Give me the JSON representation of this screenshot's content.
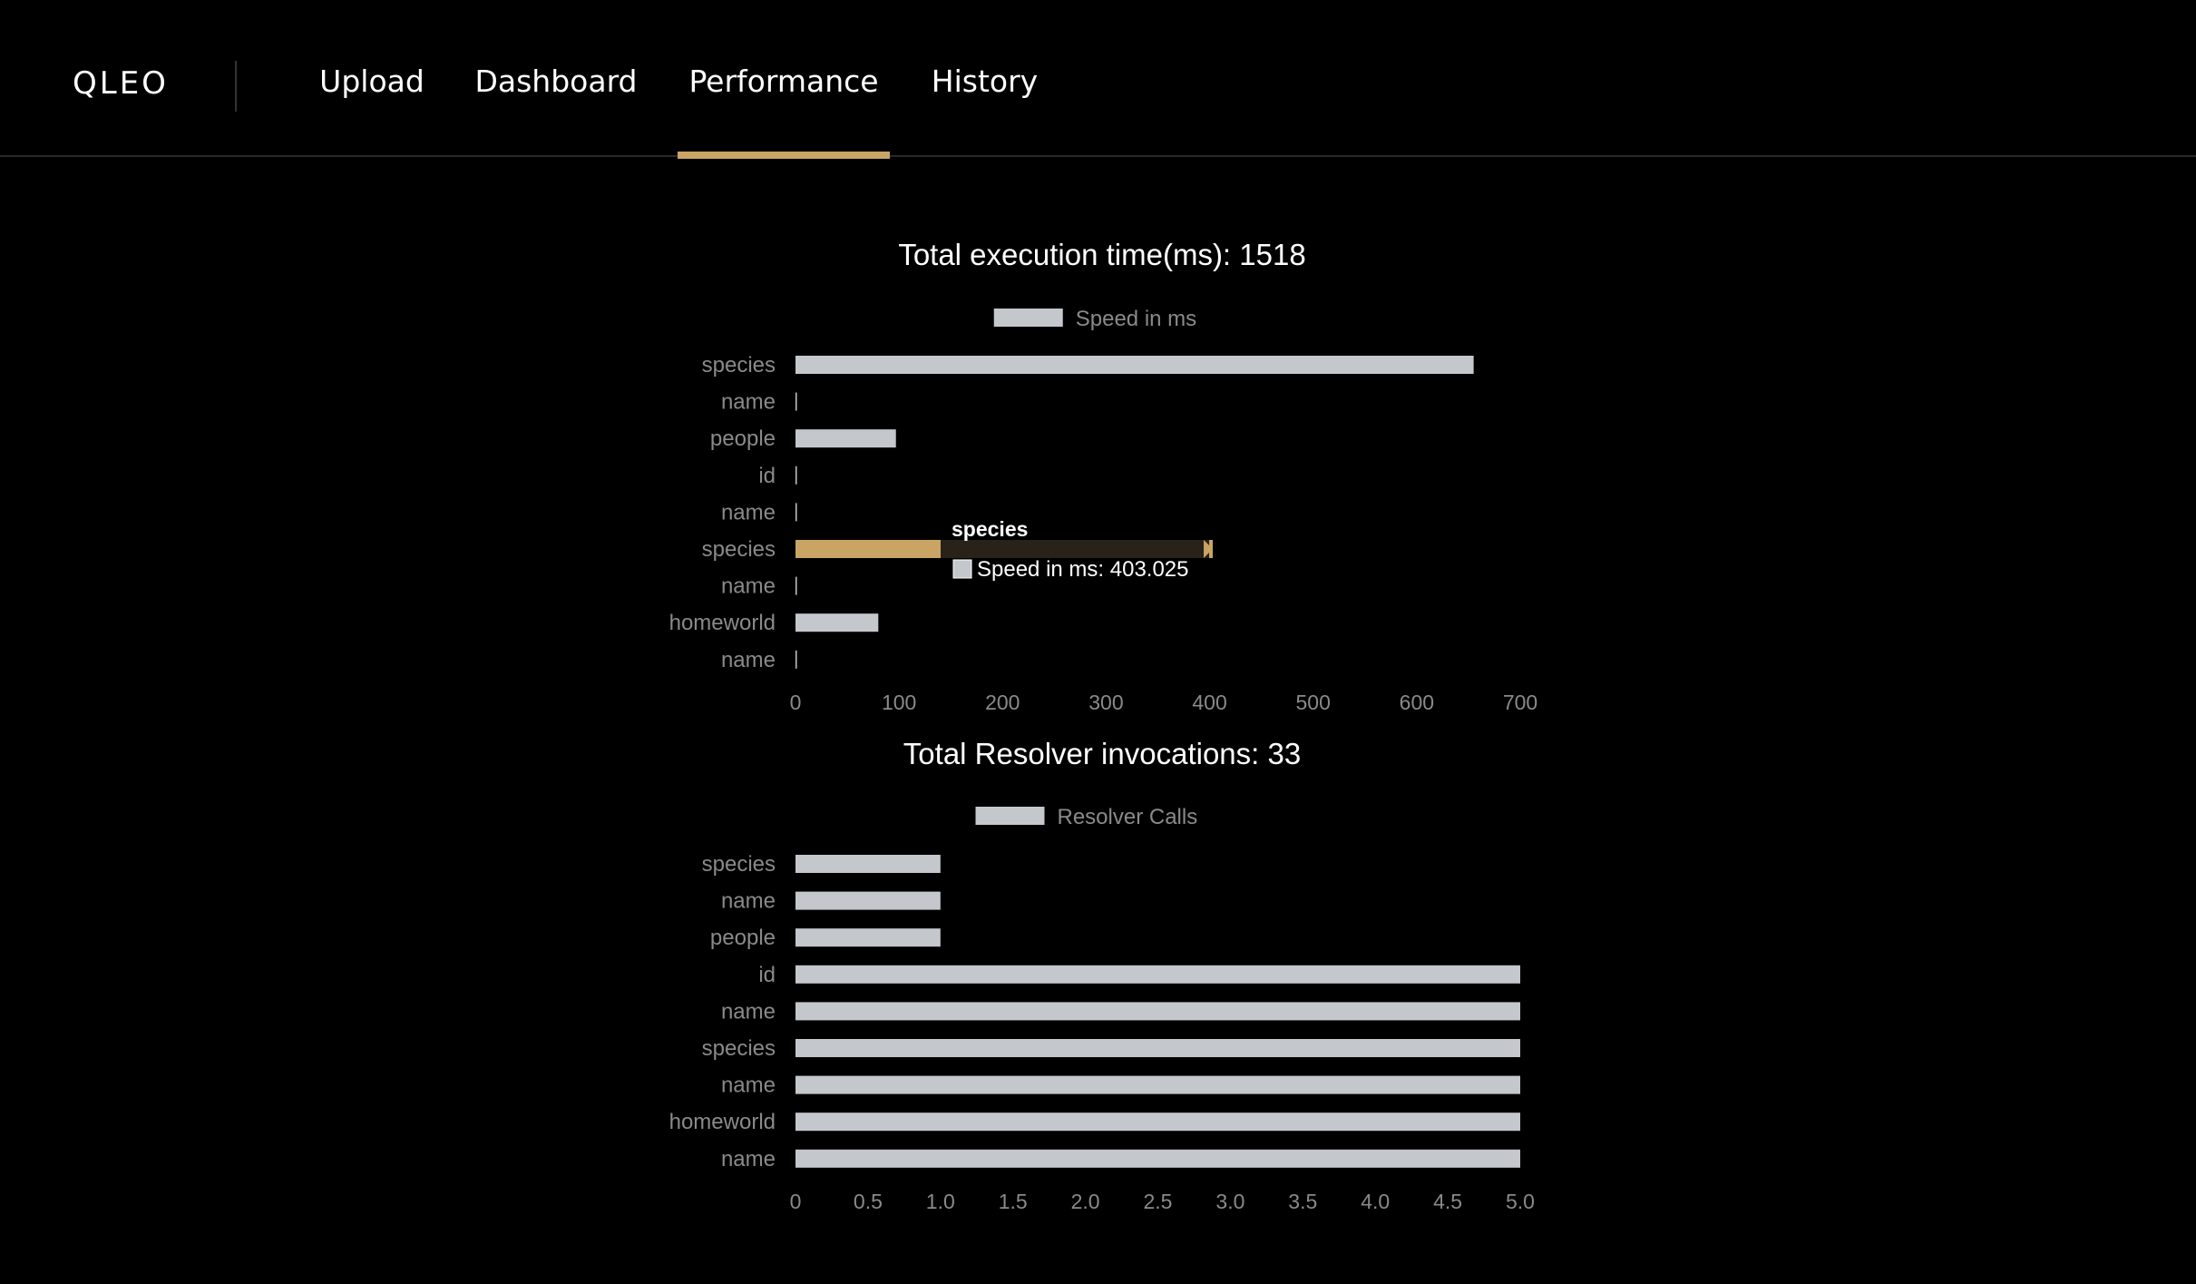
{
  "app": {
    "brand": "QLEO"
  },
  "nav": {
    "tabs": [
      {
        "label": "Upload",
        "active": false
      },
      {
        "label": "Dashboard",
        "active": false
      },
      {
        "label": "Performance",
        "active": true
      },
      {
        "label": "History",
        "active": false
      }
    ]
  },
  "colors": {
    "background": "#000000",
    "bar": "#c4c7cc",
    "highlight": "#c9a464",
    "axis_text": "#8a8a8a",
    "tooltip_bg": "#1a1712"
  },
  "chart_data": [
    {
      "type": "bar",
      "orientation": "horizontal",
      "title": "Total execution time(ms): 1518",
      "legend_label": "Speed in ms",
      "legend_position": "top",
      "categories": [
        "species",
        "name",
        "people",
        "id",
        "name",
        "species",
        "name",
        "homeworld",
        "name"
      ],
      "series": [
        {
          "name": "Speed in ms",
          "values": [
            655,
            0.5,
            97,
            0.3,
            0.4,
            403.025,
            0.3,
            80,
            0.3
          ]
        }
      ],
      "xlim": [
        0,
        700
      ],
      "x_ticks": [
        "0",
        "100",
        "200",
        "300",
        "400",
        "500",
        "600",
        "700"
      ],
      "grid": false,
      "tooltip": {
        "category_index": 5,
        "title": "species",
        "text": "Speed in ms: 403.025"
      }
    },
    {
      "type": "bar",
      "orientation": "horizontal",
      "title": "Total Resolver invocations: 33",
      "legend_label": "Resolver Calls",
      "legend_position": "top",
      "categories": [
        "species",
        "name",
        "people",
        "id",
        "name",
        "species",
        "name",
        "homeworld",
        "name"
      ],
      "series": [
        {
          "name": "Resolver Calls",
          "values": [
            1,
            1,
            1,
            5,
            5,
            5,
            5,
            5,
            5
          ]
        }
      ],
      "xlim": [
        0,
        5
      ],
      "x_ticks": [
        "0",
        "0.5",
        "1.0",
        "1.5",
        "2.0",
        "2.5",
        "3.0",
        "3.5",
        "4.0",
        "4.5",
        "5.0"
      ],
      "grid": false
    }
  ]
}
